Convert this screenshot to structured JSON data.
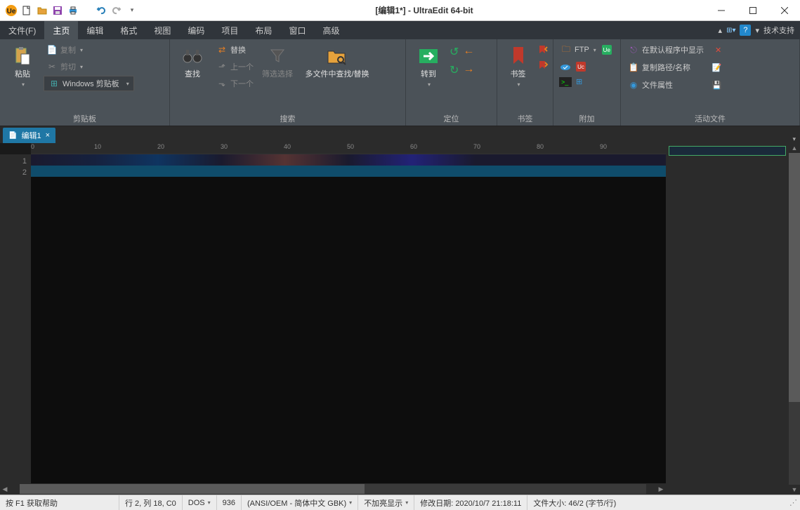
{
  "window": {
    "title": "[编辑1*] - UltraEdit 64-bit"
  },
  "menu": {
    "tabs": [
      "文件(F)",
      "主页",
      "编辑",
      "格式",
      "视图",
      "编码",
      "项目",
      "布局",
      "窗口",
      "高级"
    ],
    "active": 1,
    "support": "技术支持"
  },
  "ribbon": {
    "clipboard": {
      "label": "剪贴板",
      "paste": "粘贴",
      "copy": "复制",
      "cut": "剪切",
      "windows_clipboard": "Windows 剪贴板"
    },
    "search": {
      "label": "搜索",
      "find": "查找",
      "replace": "替换",
      "prev": "上一个",
      "next": "下一个",
      "filter": "筛选选择",
      "find_in_files": "多文件中查找/替换"
    },
    "goto": {
      "label": "定位",
      "goto": "转到"
    },
    "bookmark": {
      "label": "书签",
      "bookmark": "书签"
    },
    "attach": {
      "label": "附加",
      "ftp": "FTP"
    },
    "active_file": {
      "label": "活动文件",
      "open_default": "在默认程序中显示",
      "copy_path": "复制路径/名称",
      "properties": "文件属性"
    }
  },
  "doc": {
    "tab_name": "编辑1"
  },
  "gutter": {
    "lines": [
      "1",
      "2"
    ]
  },
  "ruler_ticks": [
    "0",
    "10",
    "20",
    "30",
    "40",
    "50",
    "60",
    "70",
    "80",
    "90"
  ],
  "status": {
    "help": "按 F1 获取帮助",
    "pos": "行 2, 列 18, C0",
    "lineend": "DOS",
    "codepage": "936",
    "encoding": "(ANSI/OEM - 简体中文 GBK)",
    "highlight": "不加亮显示",
    "modified": "修改日期: 2020/10/7 21:18:11",
    "size": "文件大小: 46/2 (字节/行)"
  }
}
